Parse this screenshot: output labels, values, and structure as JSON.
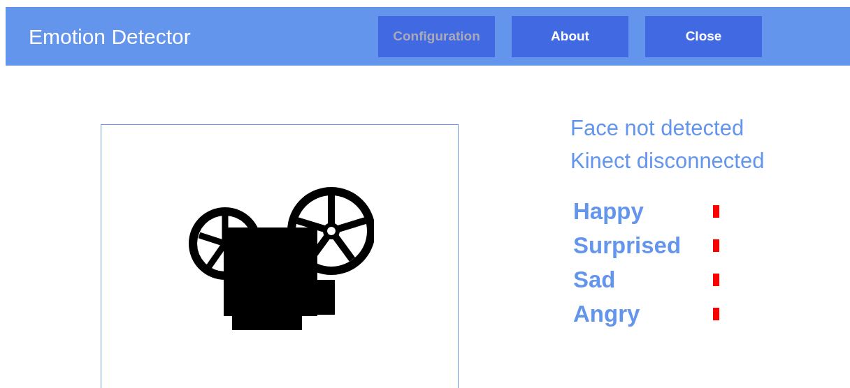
{
  "window": {
    "title": "Emotion Detector"
  },
  "buttons": [
    {
      "label": "Configuration",
      "disabled": true
    },
    {
      "label": "About",
      "disabled": false
    },
    {
      "label": "Close",
      "disabled": false
    }
  ],
  "status": [
    "Face not detected",
    "Kinect disconnected"
  ],
  "emotions": [
    {
      "name": "Happy"
    },
    {
      "name": "Surprised"
    },
    {
      "name": "Sad"
    },
    {
      "name": "Angry"
    }
  ]
}
